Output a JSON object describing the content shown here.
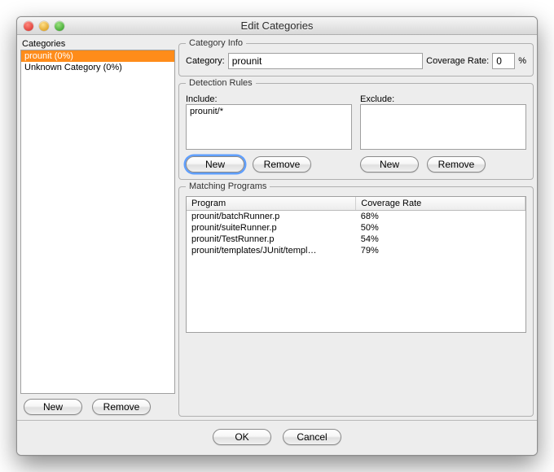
{
  "window": {
    "title": "Edit Categories"
  },
  "left": {
    "heading": "Categories",
    "items": [
      {
        "label": "prounit (0%)",
        "selected": true
      },
      {
        "label": "Unknown Category (0%)",
        "selected": false
      }
    ],
    "new_btn": "New",
    "remove_btn": "Remove"
  },
  "category_info": {
    "legend": "Category Info",
    "name_label": "Category:",
    "name_value": "prounit",
    "rate_label": "Coverage Rate:",
    "rate_value": "0",
    "percent": "%"
  },
  "detection": {
    "legend": "Detection Rules",
    "include_label": "Include:",
    "exclude_label": "Exclude:",
    "include_items": [
      "prounit/*"
    ],
    "exclude_items": [],
    "new_btn": "New",
    "remove_btn": "Remove"
  },
  "matching": {
    "legend": "Matching Programs",
    "col_program": "Program",
    "col_rate": "Coverage Rate",
    "rows": [
      {
        "program": "prounit/batchRunner.p",
        "rate": "68%"
      },
      {
        "program": "prounit/suiteRunner.p",
        "rate": "50%"
      },
      {
        "program": "prounit/TestRunner.p",
        "rate": "54%"
      },
      {
        "program": "prounit/templates/JUnit/templ…",
        "rate": "79%"
      }
    ]
  },
  "footer": {
    "ok": "OK",
    "cancel": "Cancel"
  }
}
